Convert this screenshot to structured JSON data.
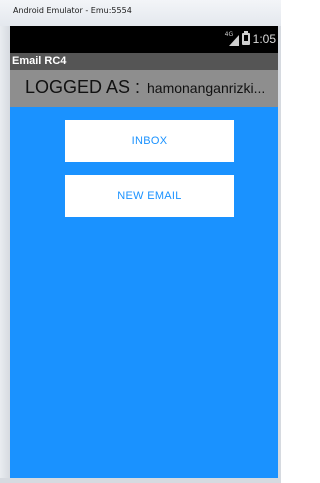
{
  "window": {
    "title": "Android Emulator - Emu:5554"
  },
  "statusbar": {
    "time": "1:05",
    "network": "4G",
    "icons": [
      "signal-icon",
      "battery-icon"
    ]
  },
  "app": {
    "title": "Email RC4"
  },
  "login": {
    "label": "LOGGED AS :",
    "username": "hamonanganrizki..."
  },
  "buttons": {
    "inbox": "INBOX",
    "new_email": "NEW EMAIL"
  },
  "colors": {
    "background": "#1a92ff",
    "app_bar": "#555555",
    "login_bar": "#8e8e8e",
    "button_text": "#1a92ff"
  }
}
